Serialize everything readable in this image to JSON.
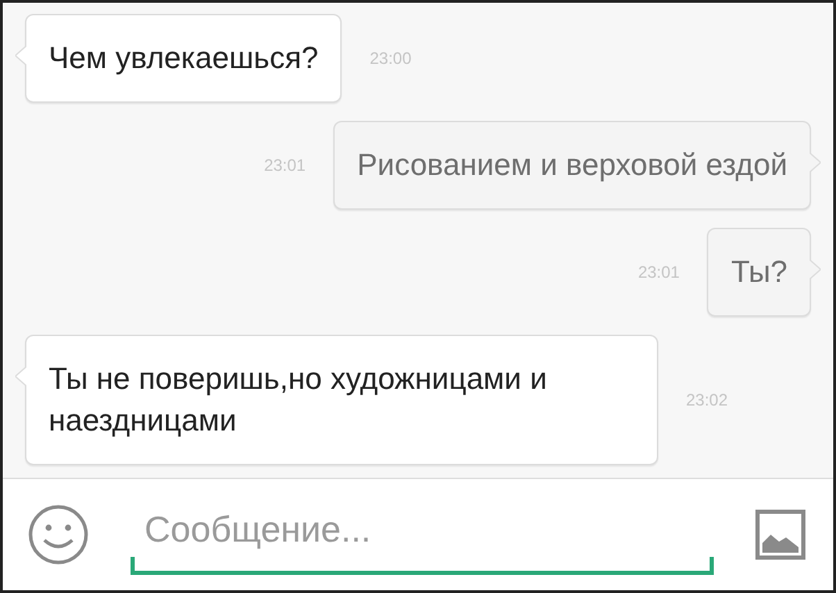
{
  "messages": [
    {
      "kind": "incoming",
      "text": "Чем увлекаешься?",
      "time": "23:00"
    },
    {
      "kind": "outgoing",
      "text": "Рисованием и верховой ездой",
      "time": "23:01"
    },
    {
      "kind": "outgoing",
      "text": "Ты?",
      "time": "23:01"
    },
    {
      "kind": "incoming",
      "text": "Ты не поверишь,но художницами и наездницами",
      "time": "23:02"
    }
  ],
  "composer": {
    "placeholder": "Сообщение..."
  }
}
